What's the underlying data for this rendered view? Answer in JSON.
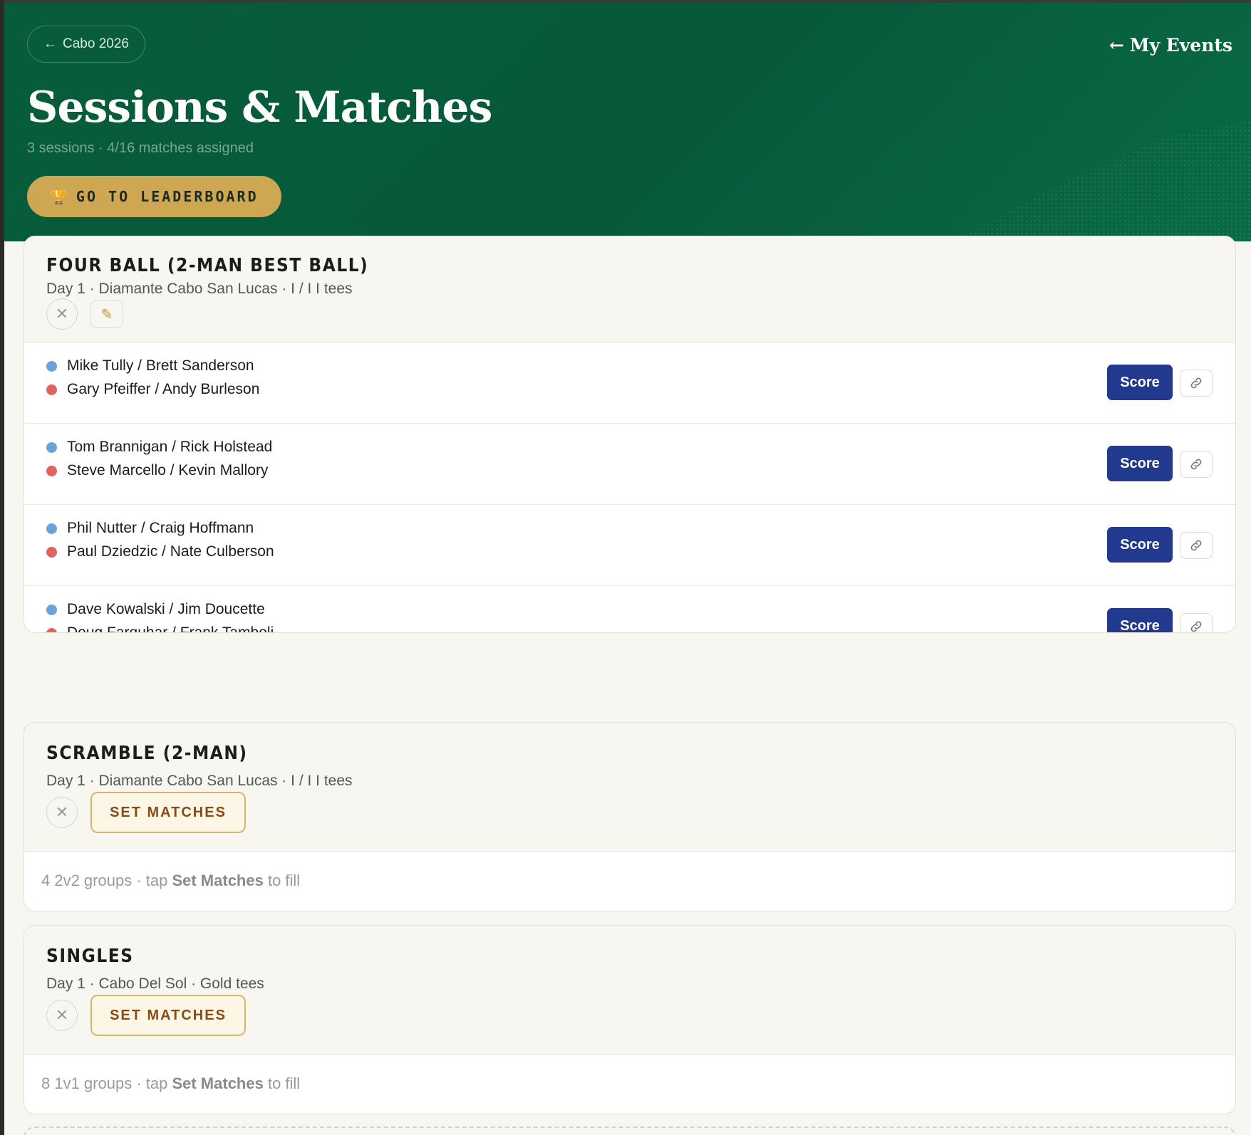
{
  "header": {
    "back_label": "Cabo 2026",
    "my_events_label": "My Events",
    "title": "Sessions & Matches",
    "subtitle": "3 sessions · 4/16 matches assigned",
    "leaderboard_label": "GO TO LEADERBOARD"
  },
  "sessions": [
    {
      "title": "FOUR BALL (2-MAN BEST BALL)",
      "meta": "Day 1 · Diamante Cabo San Lucas · I / I I tees",
      "matches": [
        {
          "team_a": "Mike Tully / Brett Sanderson",
          "team_b": "Gary Pfeiffer / Andy Burleson"
        },
        {
          "team_a": "Tom Brannigan / Rick Holstead",
          "team_b": "Steve Marcello / Kevin Mallory"
        },
        {
          "team_a": "Phil Nutter / Craig Hoffmann",
          "team_b": "Paul Dziedzic / Nate Culberson"
        },
        {
          "team_a": "Dave Kowalski / Jim Doucette",
          "team_b": "Doug Farquhar / Frank Tamboli"
        }
      ],
      "score_label": "Score"
    },
    {
      "title": "SCRAMBLE (2-MAN)",
      "meta": "Day 1 · Diamante Cabo San Lucas · I / I I tees",
      "set_matches_label": "SET MATCHES",
      "hint_prefix": "4 2v2 groups · tap ",
      "hint_bold": "Set Matches",
      "hint_suffix": " to fill"
    },
    {
      "title": "SINGLES",
      "meta": "Day 1 · Cabo Del Sol · Gold tees",
      "set_matches_label": "SET MATCHES",
      "hint_prefix": "8 1v1 groups · tap ",
      "hint_bold": "Set Matches",
      "hint_suffix": " to fill"
    }
  ],
  "colors": {
    "header_bg": "#075c3a",
    "gold": "#cda752",
    "score_btn": "#213a8d",
    "team_blue": "#6aa3dc",
    "team_red": "#e0635e"
  },
  "icons": {
    "back": "arrow-left-icon",
    "trophy": "trophy-icon",
    "remove": "close-icon",
    "edit": "pencil-icon",
    "share": "link-icon"
  }
}
